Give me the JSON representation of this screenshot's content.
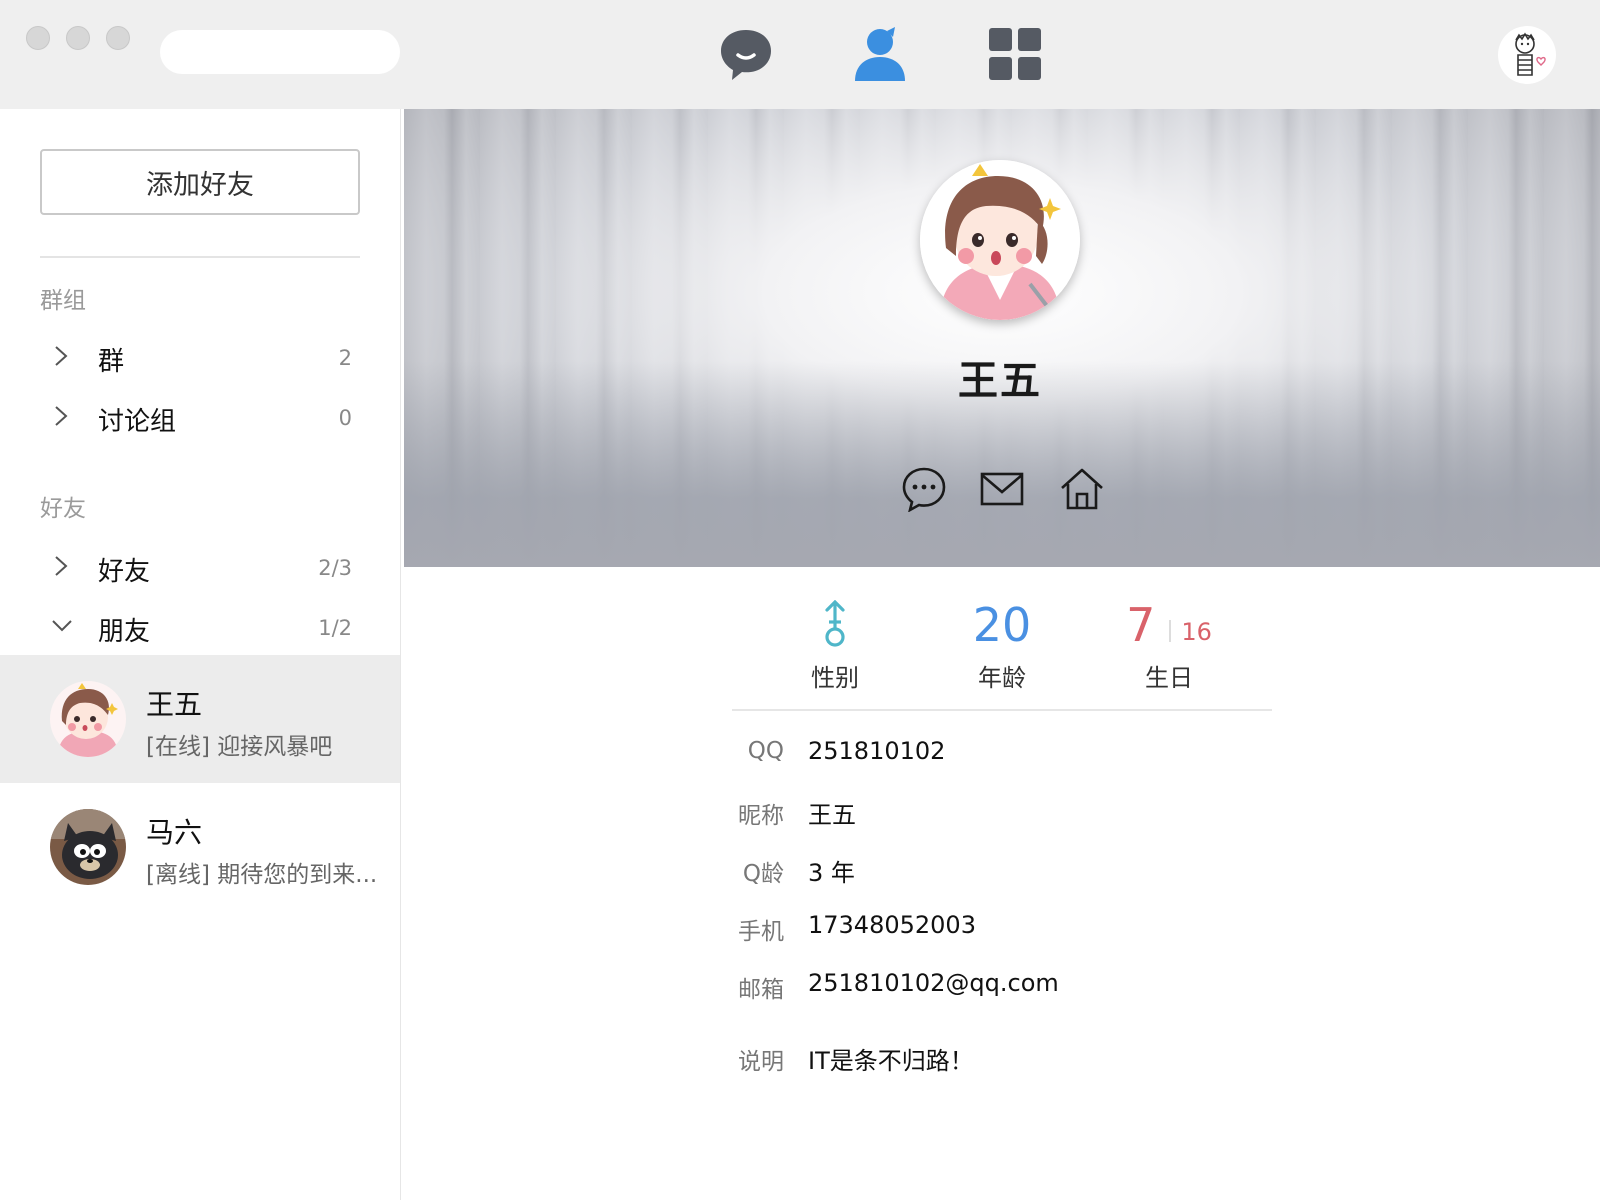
{
  "window": {
    "colors": {
      "accent": "#3b8fe0",
      "selected_bg": "#ececec",
      "age_blue": "#4a90e2",
      "birthday_red": "#d9626a"
    }
  },
  "toolbar": {
    "search": {
      "placeholder": ""
    },
    "nav": [
      {
        "icon": "chat-bubble-icon",
        "active": false
      },
      {
        "icon": "contacts-person-icon",
        "active": true
      },
      {
        "icon": "apps-grid-icon",
        "active": false
      }
    ],
    "user_avatar_icon": "doodle-avatar-icon"
  },
  "sidebar": {
    "add_friend_label": "添加好友",
    "groups_section": "群组",
    "groups": [
      {
        "label": "群",
        "count": "2",
        "expanded": false
      },
      {
        "label": "讨论组",
        "count": "0",
        "expanded": false
      }
    ],
    "friends_section": "好友",
    "friend_groups": [
      {
        "label": "好友",
        "count": "2/3",
        "expanded": false
      },
      {
        "label": "朋友",
        "count": "1/2",
        "expanded": true
      }
    ],
    "friends": [
      {
        "name": "王五",
        "status": "[在线] 迎接风暴吧",
        "selected": true
      },
      {
        "name": "马六",
        "status": "[离线] 期待您的到来...",
        "selected": false
      }
    ]
  },
  "profile": {
    "name": "王五",
    "actions": [
      "message-icon",
      "mail-icon",
      "home-icon"
    ],
    "stats": {
      "gender_label": "性别",
      "age_value": "20",
      "age_label": "年龄",
      "birthday_month": "7",
      "birthday_day": "16",
      "birthday_label": "生日"
    },
    "info": [
      {
        "key": "QQ",
        "value": "251810102"
      },
      {
        "key": "昵称",
        "value": "王五"
      },
      {
        "key": "Q龄",
        "value": "3 年"
      },
      {
        "key": "手机",
        "value": "17348052003"
      },
      {
        "key": "邮箱",
        "value": "251810102@qq.com"
      },
      {
        "key": "说明",
        "value": "IT是条不归路！"
      }
    ]
  }
}
